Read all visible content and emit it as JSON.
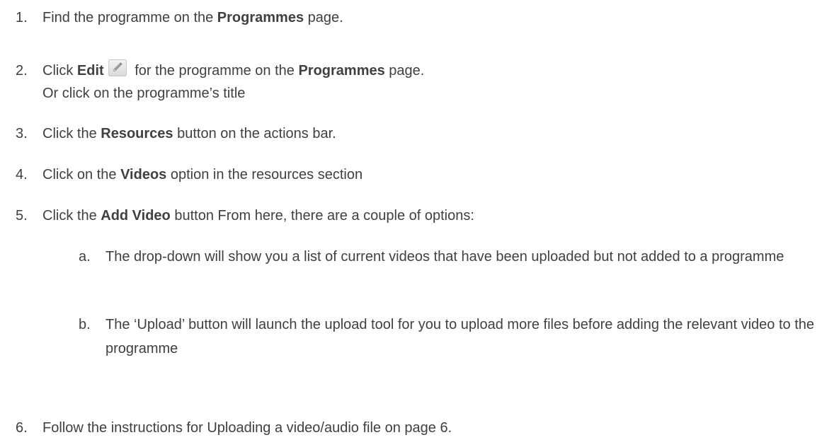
{
  "steps": [
    {
      "num": "1.",
      "t1": "Find the programme on the ",
      "b1": "Programmes",
      "t2": " page."
    },
    {
      "num": "2.",
      "t1": "Click ",
      "b1": "Edit",
      "t2": " for the programme on the ",
      "b2": "Programmes",
      "t3": " page.",
      "line2": "Or click on the programme’s title"
    },
    {
      "num": "3.",
      "t1": "Click the ",
      "b1": "Resources",
      "t2": " button on the actions bar."
    },
    {
      "num": "4.",
      "t1": "Click on the ",
      "b1": "Videos",
      "t2": " option in the resources section"
    },
    {
      "num": "5.",
      "t1": "Click the ",
      "b1": "Add Video",
      "t2": " button From here, there are a couple of options:"
    },
    {
      "num": "6.",
      "t1": "Follow the instructions for Uploading a video/audio file on page 6."
    }
  ],
  "substeps": [
    {
      "letter": "a.",
      "text": "The drop-down will show you a list of current videos that have been uploaded but not added to a programme"
    },
    {
      "letter": "b.",
      "text": "The ‘Upload’ button will launch the upload tool for you to upload more files before adding the relevant video to the programme"
    }
  ],
  "icons": {
    "edit": "pencil-icon"
  }
}
